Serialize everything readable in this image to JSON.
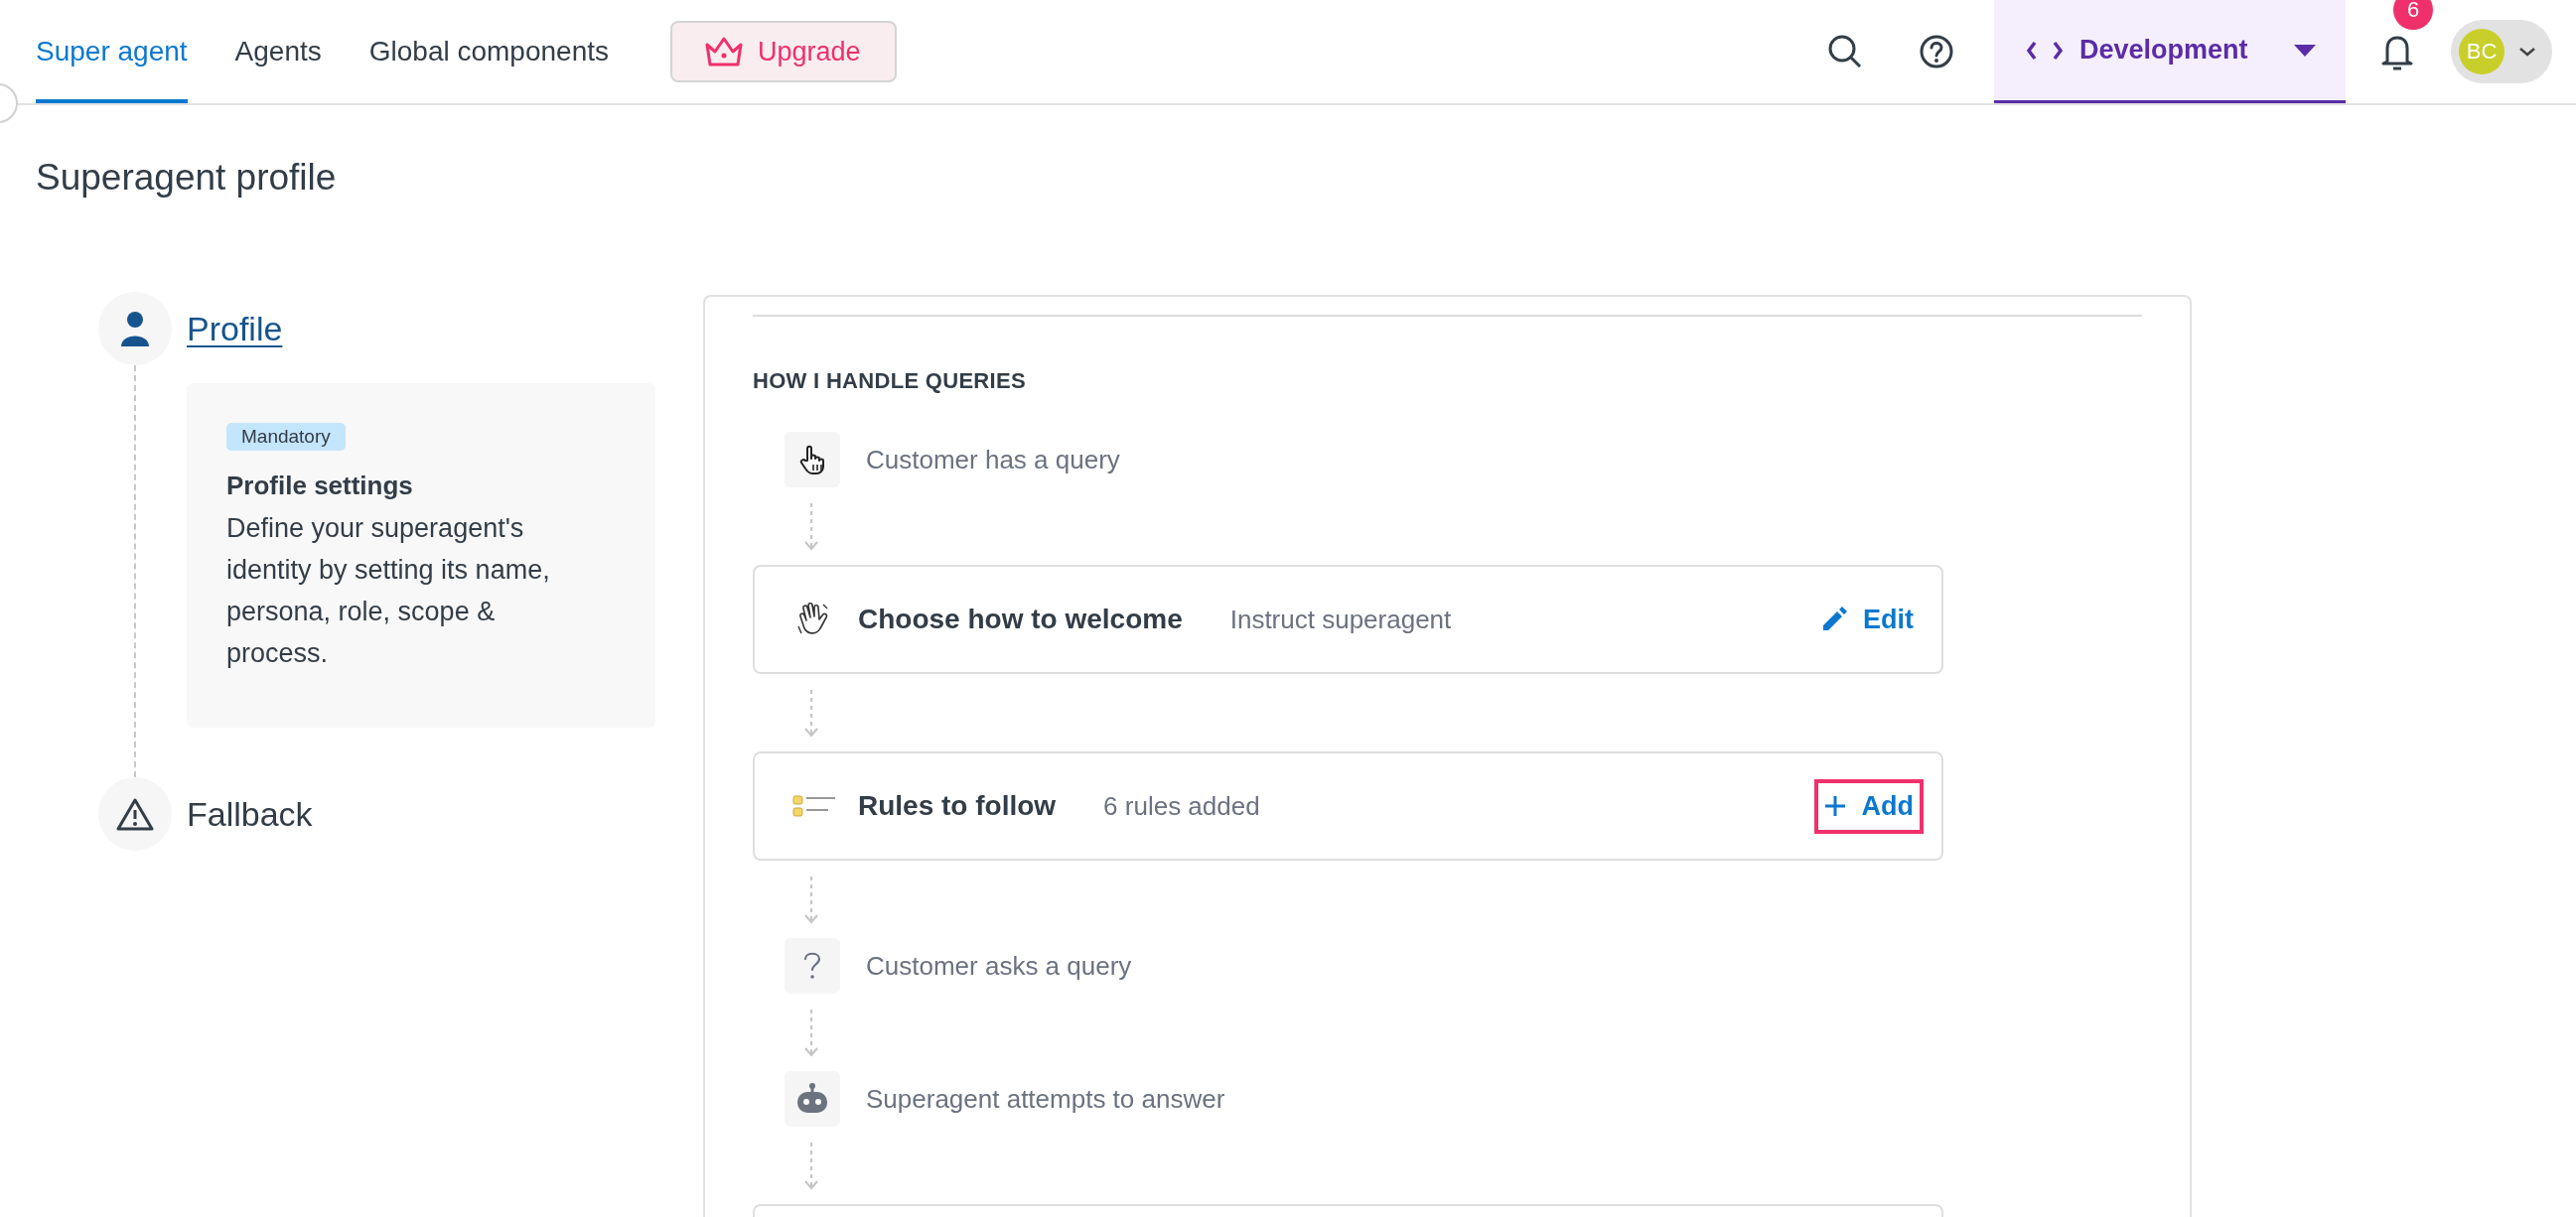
{
  "nav": {
    "tabs": [
      {
        "label": "Super agent",
        "selected": true
      },
      {
        "label": "Agents",
        "selected": false
      },
      {
        "label": "Global components",
        "selected": false
      }
    ],
    "upgrade_button": "Upgrade",
    "environment": "Development",
    "notification_count": "6",
    "user_initials": "BC"
  },
  "page_title": "Superagent profile",
  "steps": [
    {
      "kind": "profile",
      "label": "Profile",
      "selected": true,
      "details": {
        "badge": "Mandatory",
        "title": "Profile settings",
        "description": "Define your superagent's identity by setting its name, persona, role, scope & process."
      }
    },
    {
      "kind": "fallback",
      "label": "Fallback",
      "selected": false
    }
  ],
  "queries": {
    "heading": "HOW I HANDLE QUERIES",
    "flow": [
      {
        "kind": "trigger",
        "text": "Customer has a query"
      },
      {
        "kind": "welcome",
        "title": "Choose how to welcome",
        "subtitle": "Instruct superagent",
        "action": {
          "kind": "edit",
          "label": "Edit",
          "highlighted": false
        }
      },
      {
        "kind": "rules",
        "title": "Rules to follow",
        "subtitle": "6 rules added",
        "action": {
          "kind": "add",
          "label": "Add",
          "highlighted": true
        }
      },
      {
        "kind": "question",
        "text": "Customer asks a query"
      },
      {
        "kind": "answer",
        "text": "Superagent attempts to answer"
      },
      {
        "kind": "placeholder"
      }
    ]
  }
}
